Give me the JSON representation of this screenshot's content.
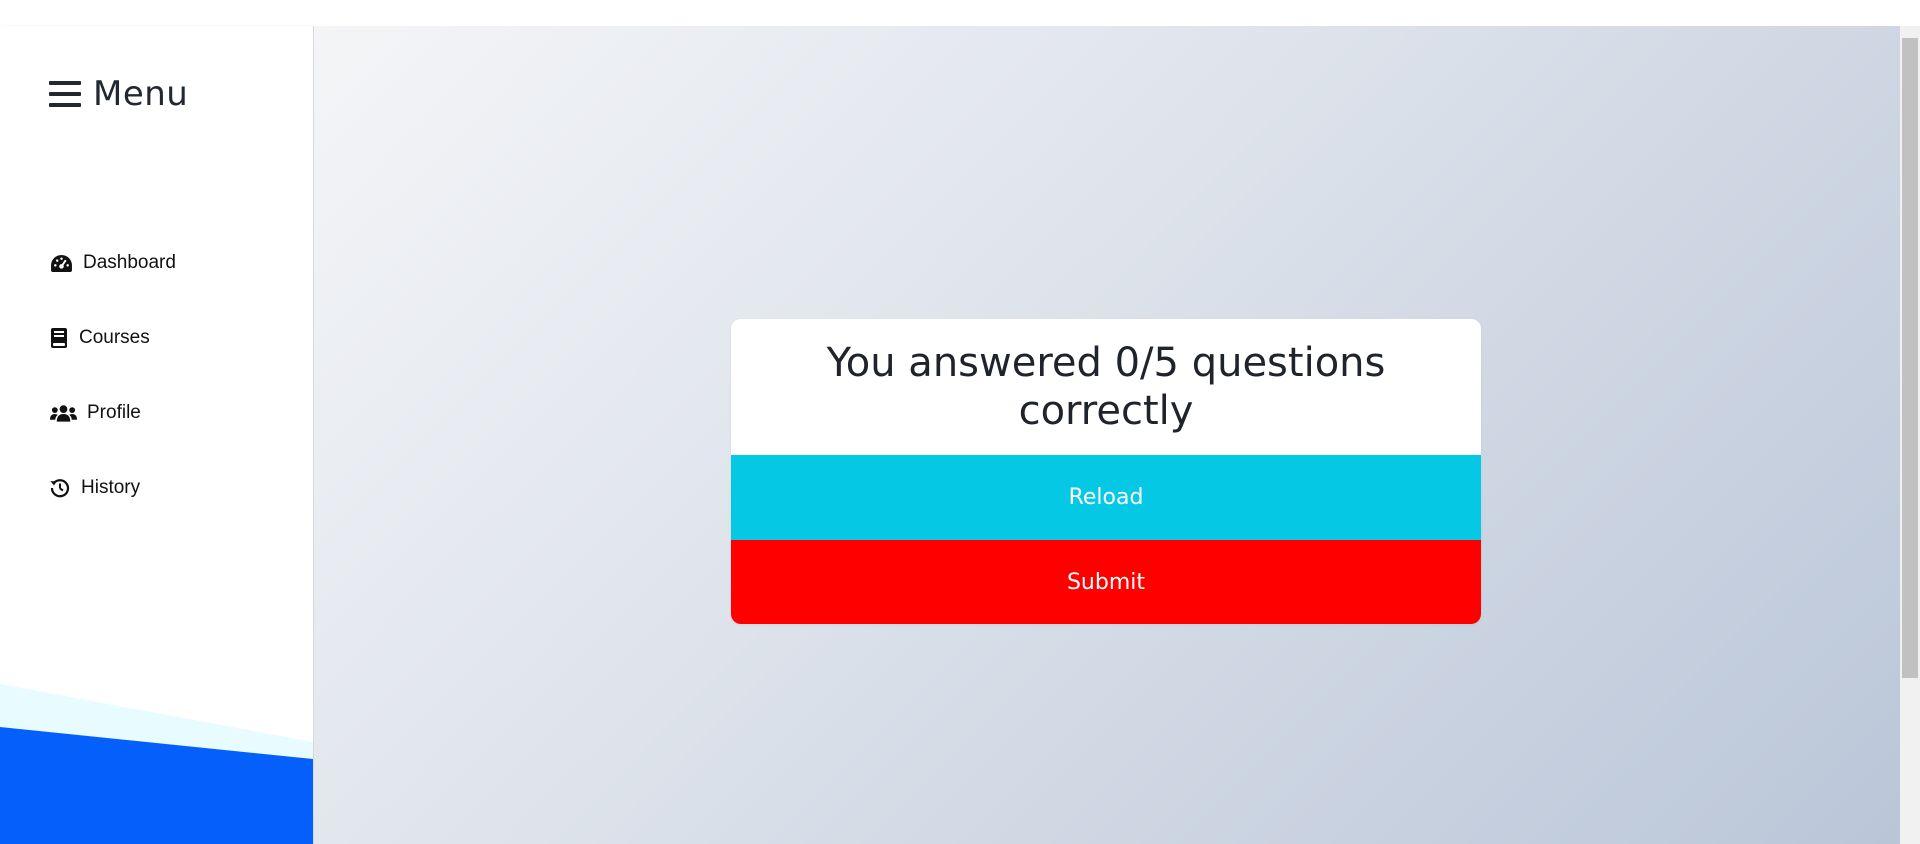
{
  "sidebar": {
    "title": "Menu",
    "items": [
      {
        "label": "Dashboard",
        "icon": "dashboard-gauge-icon"
      },
      {
        "label": "Courses",
        "icon": "book-icon"
      },
      {
        "label": "Profile",
        "icon": "users-icon"
      },
      {
        "label": "History",
        "icon": "history-icon"
      }
    ]
  },
  "result": {
    "text": "You answered 0/5 questions correctly"
  },
  "buttons": {
    "reload": "Reload",
    "submit": "Submit"
  },
  "colors": {
    "reload": "#05c9e4",
    "submit": "#ff0000",
    "wave_blue": "#0560fb",
    "wave_light": "#e8fbff"
  }
}
